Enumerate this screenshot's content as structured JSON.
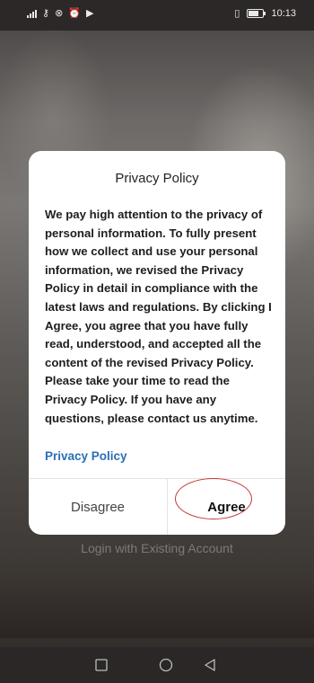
{
  "status_bar": {
    "time": "10:13",
    "left_icons": [
      "signal-icon",
      "key-icon",
      "alarm-off-icon",
      "alarm-icon",
      "cast-icon"
    ],
    "right_icons": [
      "vibrate-icon",
      "battery-icon"
    ],
    "battery_level": 0.7
  },
  "dialog": {
    "title": "Privacy Policy",
    "body": "We pay high attention to the privacy of personal information. To fully present how we collect and use your personal information, we revised the Privacy Policy in detail in compliance with the latest laws and regulations. By clicking I Agree, you agree that you have fully read, understood, and accepted all the content of the revised Privacy Policy. Please take your time to read the Privacy Policy. If you have any questions, please contact us anytime.",
    "link_label": "Privacy Policy",
    "disagree_label": "Disagree",
    "agree_label": "Agree"
  },
  "background": {
    "login_existing_label": "Login with Existing Account"
  },
  "nav_bar": {
    "recent_glyph": "□",
    "home_glyph": "○",
    "back_glyph": "◁"
  },
  "colors": {
    "link": "#2a6fb5",
    "highlight_circle": "#c43838"
  }
}
